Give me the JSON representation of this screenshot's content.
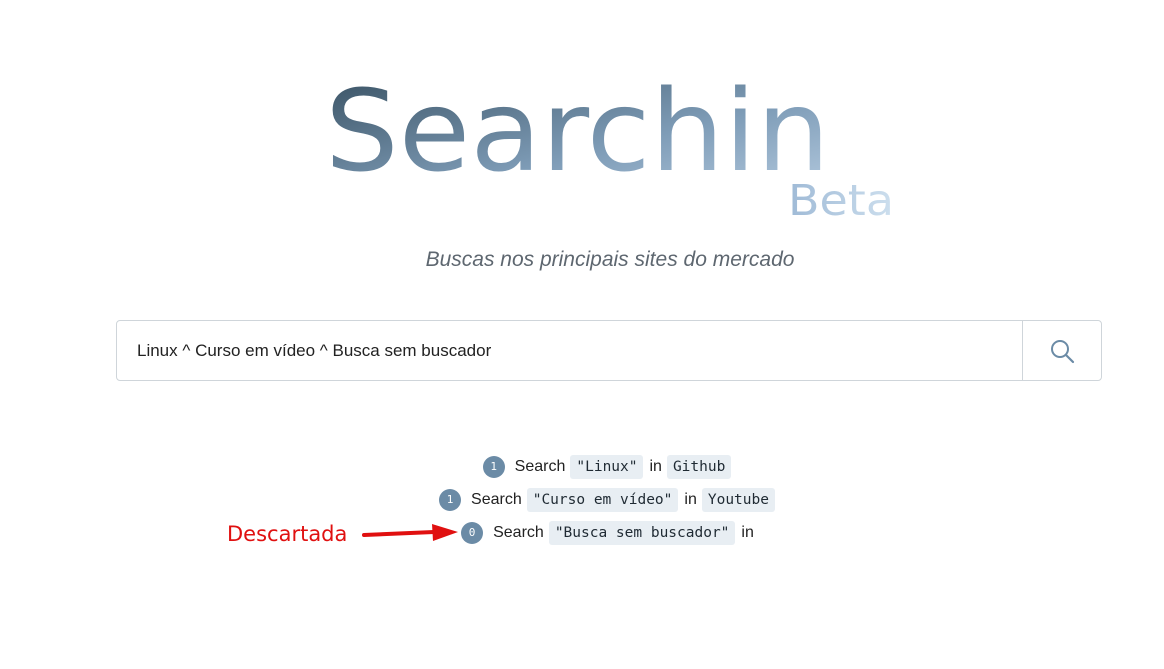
{
  "logo": {
    "title": "Searchin",
    "badge": "Beta"
  },
  "tagline": "Buscas nos principais sites do mercado",
  "search": {
    "value": "Linux ^ Curso em vídeo ^ Busca sem buscador",
    "button_icon": "search-icon"
  },
  "results": [
    {
      "count": "1",
      "word": "Search",
      "query": "\"Linux\"",
      "in": "in",
      "site": "Github"
    },
    {
      "count": "1",
      "word": "Search",
      "query": "\"Curso em vídeo\"",
      "in": "in",
      "site": "Youtube"
    },
    {
      "count": "0",
      "word": "Search",
      "query": "\"Busca sem buscador\"",
      "in": "in",
      "site": ""
    }
  ],
  "annotation": {
    "label": "Descartada",
    "color": "#e01010"
  },
  "colors": {
    "logo_dark": "#3f5566",
    "logo_light": "#a7c0da",
    "badge": "#6b8ba6",
    "code_bg": "#e8eef3"
  }
}
